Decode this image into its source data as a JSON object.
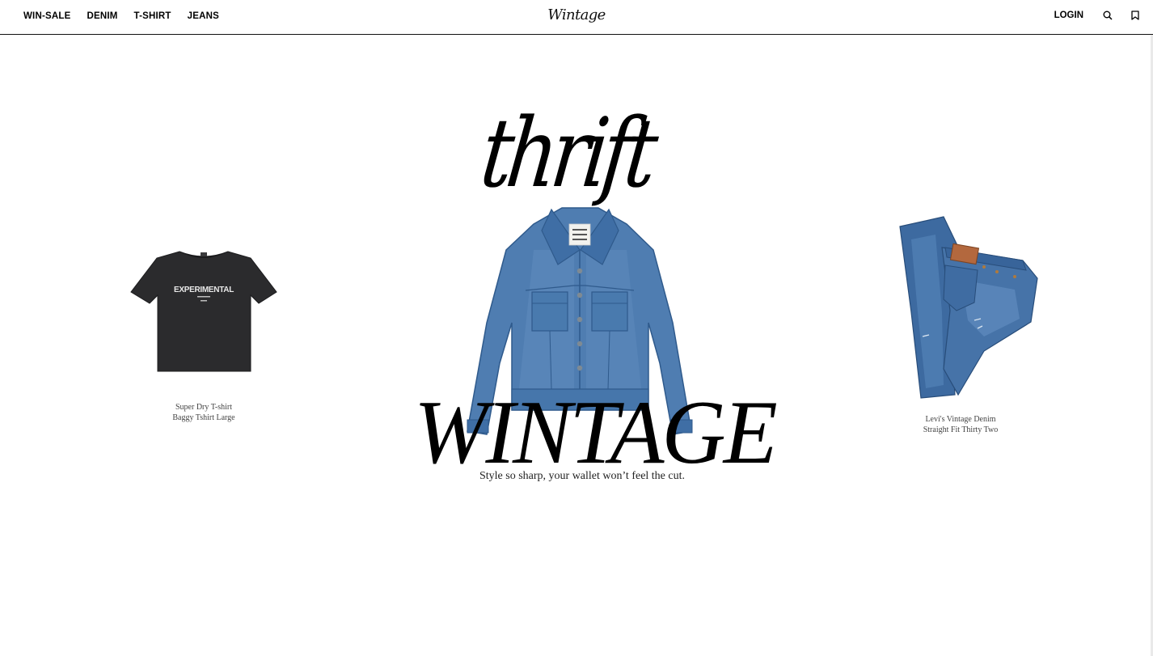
{
  "nav": {
    "links": [
      "WIN-SALE",
      "DENIM",
      "T-SHIRT",
      "JEANS"
    ],
    "brand": "Wintage",
    "login": "LOGIN",
    "icons": [
      "search-icon",
      "bookmark-icon"
    ]
  },
  "hero": {
    "script_word": "thrift",
    "title": "WINTAGE",
    "tagline": "Style so sharp, your wallet won’t feel the cut."
  },
  "products": [
    {
      "line1": "Super Dry T-shirt",
      "line2": "Baggy Tshirt Large",
      "print": "EXPERIMENTAL"
    },
    {
      "line1": "Levi's Vintage Denim",
      "line2": "Straight Fit Thirty Two"
    }
  ],
  "colors": {
    "text": "#000000",
    "tshirt": "#2b2b2d",
    "denim": "#4f7db1",
    "denim_dark": "#2f5a8c",
    "leather_patch": "#b3683e"
  }
}
